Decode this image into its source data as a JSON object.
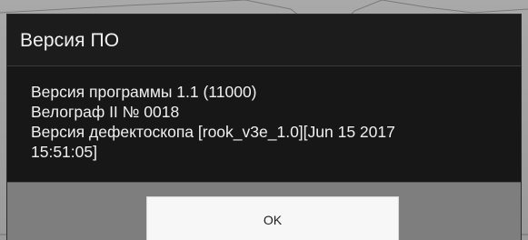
{
  "dialog": {
    "title": "Версия ПО",
    "lines": [
      "Версия программы 1.1 (11000)",
      "Велограф II № 0018",
      "Версия дефектоскопа [rook_v3e_1.0][Jun 15 2017",
      "15:51:05]"
    ],
    "ok_label": "OK"
  },
  "colors": {
    "dialog_bg": "#171717",
    "button_bar_bg": "#7e7e7e",
    "button_bg": "#f7f7f7",
    "text": "#f0f0f0"
  }
}
